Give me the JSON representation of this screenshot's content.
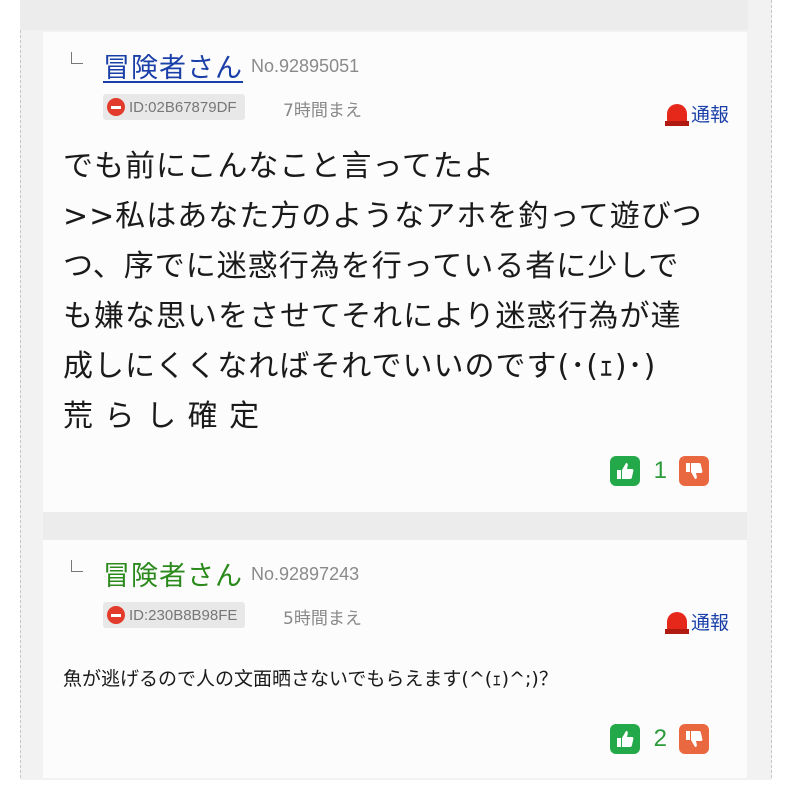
{
  "posts": [
    {
      "name": "冒険者さん",
      "res_no": "No.92895051",
      "id": "ID:02B67879DF",
      "time_ago": "7時間まえ",
      "report_label": "通報",
      "body_lines": [
        "でも前にこんなこと言ってたよ",
        ">>私はあなた方のようなアホを釣って遊びつ",
        "つ、序でに迷惑行為を行っている者に少しで",
        "も嫌な思いをさせてそれにより迷惑行為が達",
        "成しにくくなればそれでいいのです(･(ｪ)･)",
        "荒 ら し 確 定"
      ],
      "like_count": "1",
      "name_color": "#1a3fa8"
    },
    {
      "name": "冒険者さん",
      "res_no": "No.92897243",
      "id": "ID:230B8B98FE",
      "time_ago": "5時間まえ",
      "report_label": "通報",
      "body_text": "魚が逃げるので人の文面晒さないでもらえます(^(ｪ)^;)？",
      "like_count": "2",
      "name_color": "#2b8a1c"
    }
  ],
  "icons": {
    "ban": "ban-icon",
    "report": "siren-icon",
    "like": "thumbs-up-icon",
    "dislike": "thumbs-down-icon"
  },
  "colors": {
    "like": "#23a84a",
    "dislike": "#e9683f",
    "report": "#e6281b"
  }
}
